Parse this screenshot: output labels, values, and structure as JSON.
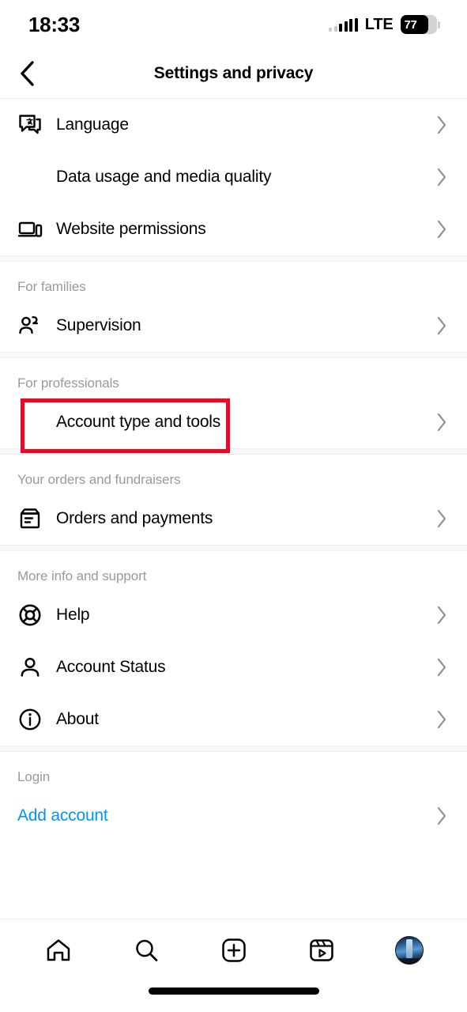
{
  "status_bar": {
    "time": "18:33",
    "network": "LTE",
    "battery_percent": "77",
    "battery_level": 77,
    "signal_icon": "signal-bars-icon",
    "battery_icon": "battery-icon"
  },
  "header": {
    "title": "Settings and privacy",
    "back_icon": "chevron-left-icon"
  },
  "colors": {
    "accent_link": "#0095F6",
    "highlight_box": "#E8092A",
    "section_header_text": "#9A9A9A",
    "chevron": "#8E8E8E",
    "divider_band": "#F8F8F8"
  },
  "sections": [
    {
      "header": null,
      "items": [
        {
          "label": "Language",
          "icon": "translate-bubble-icon",
          "chevron": "chevron-right-icon",
          "highlighted": false,
          "link": false
        },
        {
          "label": "Data usage and media quality",
          "icon": null,
          "chevron": "chevron-right-icon",
          "highlighted": false,
          "link": false
        },
        {
          "label": "Website permissions",
          "icon": "devices-icon",
          "chevron": "chevron-right-icon",
          "highlighted": false,
          "link": false
        }
      ]
    },
    {
      "header": "For families",
      "items": [
        {
          "label": "Supervision",
          "icon": "people-icon",
          "chevron": "chevron-right-icon",
          "highlighted": false,
          "link": false
        }
      ]
    },
    {
      "header": "For professionals",
      "items": [
        {
          "label": "Account type and tools",
          "icon": null,
          "chevron": "chevron-right-icon",
          "highlighted": true,
          "link": false
        }
      ]
    },
    {
      "header": "Your orders and fundraisers",
      "items": [
        {
          "label": "Orders and payments",
          "icon": "orders-box-icon",
          "chevron": "chevron-right-icon",
          "highlighted": false,
          "link": false
        }
      ]
    },
    {
      "header": "More info and support",
      "items": [
        {
          "label": "Help",
          "icon": "lifebuoy-icon",
          "chevron": "chevron-right-icon",
          "highlighted": false,
          "link": false
        },
        {
          "label": "Account Status",
          "icon": "person-icon",
          "chevron": "chevron-right-icon",
          "highlighted": false,
          "link": false
        },
        {
          "label": "About",
          "icon": "info-circle-icon",
          "chevron": "chevron-right-icon",
          "highlighted": false,
          "link": false
        }
      ]
    },
    {
      "header": "Login",
      "items": [
        {
          "label": "Add account",
          "icon": null,
          "chevron": "chevron-right-icon",
          "highlighted": false,
          "link": true
        }
      ]
    }
  ],
  "bottom_nav": [
    {
      "name": "home",
      "icon": "home-icon"
    },
    {
      "name": "search",
      "icon": "search-icon"
    },
    {
      "name": "create",
      "icon": "plus-square-icon"
    },
    {
      "name": "reels",
      "icon": "reels-icon"
    },
    {
      "name": "profile",
      "icon": "avatar-icon"
    }
  ]
}
